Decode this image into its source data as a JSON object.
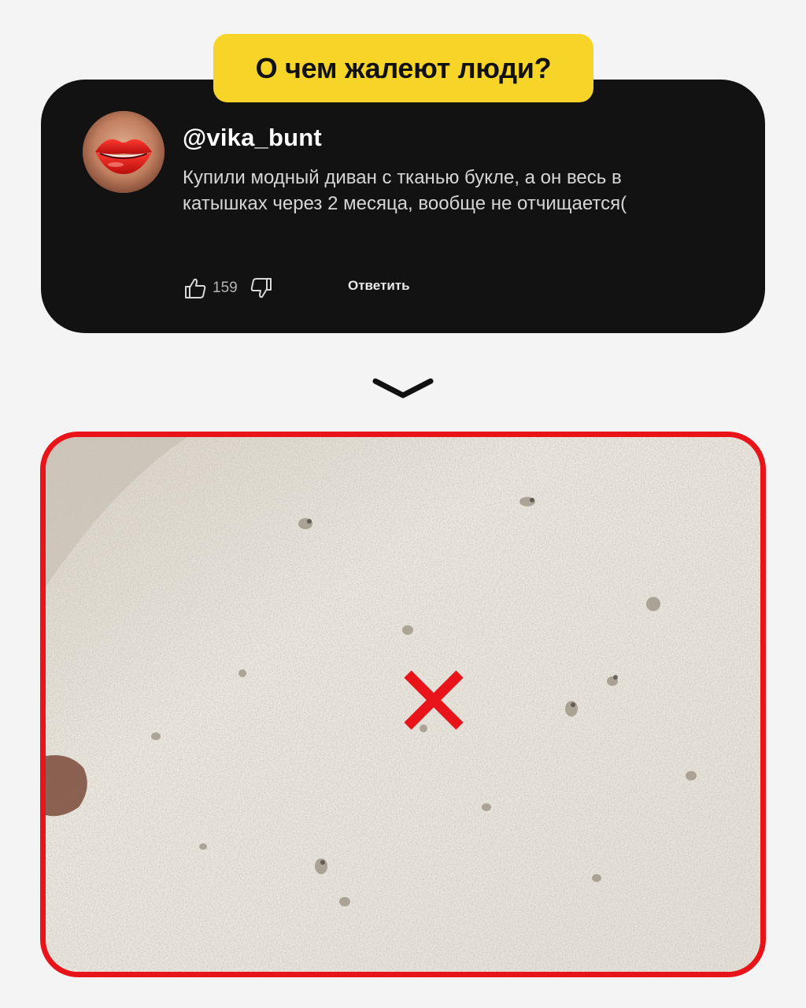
{
  "header": {
    "title": "О чем жалеют люди?"
  },
  "comment": {
    "username": "@vika_bunt",
    "text": "Купили модный диван с тканью букле, а он весь в катышках через 2 месяца, вообще не отчищается(",
    "like_count": "159",
    "reply_label": "Ответить",
    "avatar_icon": "lips-avatar",
    "like_icon": "thumbs-up-icon",
    "dislike_icon": "thumbs-down-icon"
  },
  "divider": {
    "icon": "chevron-down-icon"
  },
  "photo": {
    "subject": "boucle-fabric-with-pilling",
    "overlay_icon": "cross-mark-icon"
  },
  "colors": {
    "background": "#f4f4f4",
    "card": "#121212",
    "title_accent": "#f7d528",
    "frame_red": "#e8141a"
  }
}
